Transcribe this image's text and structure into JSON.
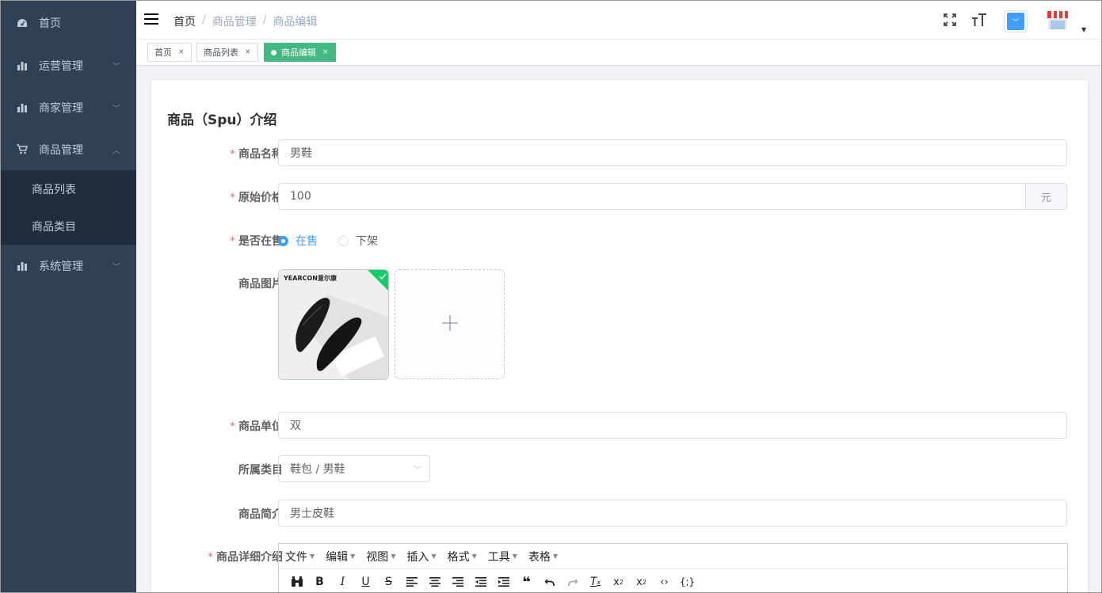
{
  "sidebar": {
    "items": [
      {
        "label": "首页",
        "icon": "dashboard-icon"
      },
      {
        "label": "运营管理",
        "icon": "bar-chart-icon"
      },
      {
        "label": "商家管理",
        "icon": "bar-chart-icon"
      },
      {
        "label": "商品管理",
        "icon": "cart-icon",
        "expanded": true,
        "children": [
          {
            "label": "商品列表"
          },
          {
            "label": "商品类目"
          }
        ]
      },
      {
        "label": "系统管理",
        "icon": "bar-chart-icon"
      }
    ]
  },
  "navbar": {
    "breadcrumb": [
      "首页",
      "商品管理",
      "商品编辑"
    ],
    "icons": [
      "fullscreen-icon",
      "font-size-icon",
      "size-select-icon",
      "avatar-shop-icon"
    ]
  },
  "tags": [
    {
      "label": "首页",
      "active": false
    },
    {
      "label": "商品列表",
      "active": false
    },
    {
      "label": "商品编辑",
      "active": true
    }
  ],
  "form": {
    "title": "商品（Spu）介绍",
    "name": {
      "label": "商品名称",
      "value": "男鞋",
      "required": true
    },
    "price": {
      "label": "原始价格",
      "value": "100",
      "unit": "元",
      "required": true
    },
    "on_sale": {
      "label": "是否在售",
      "options": [
        "在售",
        "下架"
      ],
      "selected": "在售",
      "required": true
    },
    "images": {
      "label": "商品图片",
      "brand_text": "YEARCON意尔康"
    },
    "unit": {
      "label": "商品单位",
      "value": "双",
      "required": true
    },
    "category": {
      "label": "所属类目",
      "value": "鞋包 / 男鞋"
    },
    "brief": {
      "label": "商品简介",
      "value": "男士皮鞋"
    },
    "detail": {
      "label": "商品详细介绍",
      "required": true,
      "menus": [
        "文件",
        "编辑",
        "视图",
        "插入",
        "格式",
        "工具",
        "表格"
      ],
      "toolbar": [
        "find-icon",
        "bold-icon",
        "italic-icon",
        "underline-icon",
        "strikethrough-icon",
        "align-left-icon",
        "align-center-icon",
        "align-right-icon",
        "outdent-icon",
        "indent-icon",
        "blockquote-icon",
        "undo-icon",
        "redo-icon",
        "clear-format-icon",
        "subscript-icon",
        "superscript-icon",
        "code-icon",
        "code-block-icon"
      ]
    }
  },
  "colors": {
    "sidebar_bg": "#304156",
    "submenu_bg": "#1f2d3d",
    "tag_active": "#42b983",
    "primary": "#409eff",
    "required": "#f56c6c"
  }
}
